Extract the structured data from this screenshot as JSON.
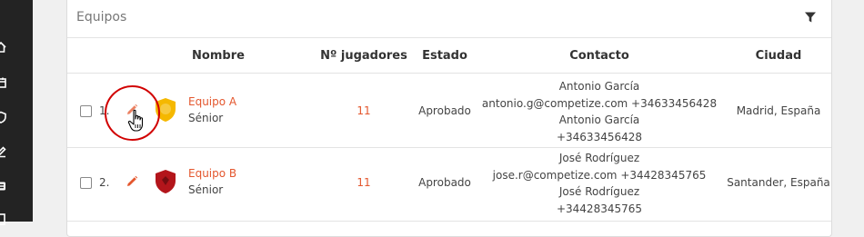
{
  "card": {
    "title": "Equipos"
  },
  "columns": {
    "name": "Nombre",
    "players": "Nº jugadores",
    "status": "Estado",
    "contact": "Contacto",
    "city": "Ciudad"
  },
  "rows": [
    {
      "num": "1.",
      "name": "Equipo A",
      "category": "Sénior",
      "players": "11",
      "status": "Aprobado",
      "contact_lines": [
        "Antonio García",
        "antonio.g@competize.com +34633456428",
        "Antonio García",
        "+34633456428"
      ],
      "city": "Madrid, España",
      "crest_color": "#f5b800"
    },
    {
      "num": "2.",
      "name": "Equipo B",
      "category": "Sénior",
      "players": "11",
      "status": "Aprobado",
      "contact_lines": [
        "José Rodríguez",
        "jose.r@competize.com +34428345765",
        "José Rodríguez",
        "+34428345765"
      ],
      "city": "Santander, España",
      "crest_color": "#b3151b"
    }
  ],
  "colors": {
    "accent": "#e4572e",
    "sidebar": "#232323",
    "highlight": "#d10000"
  },
  "icons": {
    "sidebar": [
      "home-icon",
      "calendar-icon",
      "shield-icon",
      "edit-icon",
      "list-icon",
      "building-icon"
    ],
    "header": "filter-icon",
    "row_action": "pencil-icon"
  }
}
